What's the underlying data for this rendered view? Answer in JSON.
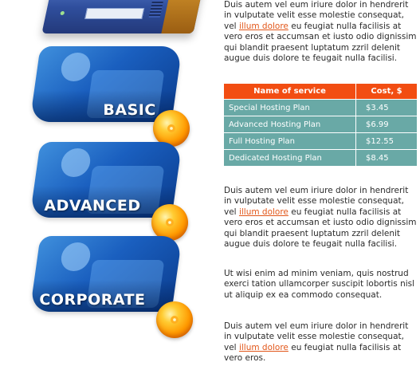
{
  "cards": [
    {
      "label": "BASIC"
    },
    {
      "label": "ADVANCED"
    },
    {
      "label": "CORPORATE"
    }
  ],
  "paragraph1": {
    "before_link": "Duis autem vel eum iriure dolor in hendrerit in vulputate velit esse molestie consequat, vel ",
    "link": "illum dolore",
    "after_link": " eu feugiat nulla facilisis at vero eros et accumsan et iusto odio dignissim qui blandit praesent luptatum zzril delenit augue duis dolore te feugait nulla facilisi."
  },
  "services_table": {
    "headers": [
      "Name of service",
      "Cost, $"
    ],
    "rows": [
      {
        "name": "Special Hosting Plan",
        "cost": "$3.45"
      },
      {
        "name": "Advanced Hosting Plan",
        "cost": "$6.99"
      },
      {
        "name": "Full Hosting Plan",
        "cost": "$12.55"
      },
      {
        "name": "Dedicated Hosting Plan",
        "cost": "$8.45"
      }
    ]
  },
  "paragraph2": {
    "before_link": "Duis autem vel eum iriure dolor in hendrerit in vulputate velit esse molestie consequat, vel ",
    "link": "illum dolore",
    "after_link": " eu feugiat nulla facilisis at vero eros et accumsan et iusto odio dignissim qui blandit praesent luptatum zzril delenit augue duis dolore te feugait nulla facilisi."
  },
  "paragraph3": {
    "text": "Ut wisi enim ad minim veniam, quis nostrud exerci tation ullamcorper suscipit lobortis nisl ut aliquip ex ea commodo consequat."
  },
  "paragraph4": {
    "before_link": "Duis autem vel eum iriure dolor in hendrerit in vulputate velit esse molestie consequat, vel ",
    "link": "illum dolore",
    "after_link": " eu feugiat nulla facilisis at vero eros."
  },
  "colors": {
    "table_header": "#f24d12",
    "table_row": "#69a9a6",
    "link": "#e2571a",
    "card_blue": "#1a5fbf",
    "orb_orange": "#ff9900"
  }
}
